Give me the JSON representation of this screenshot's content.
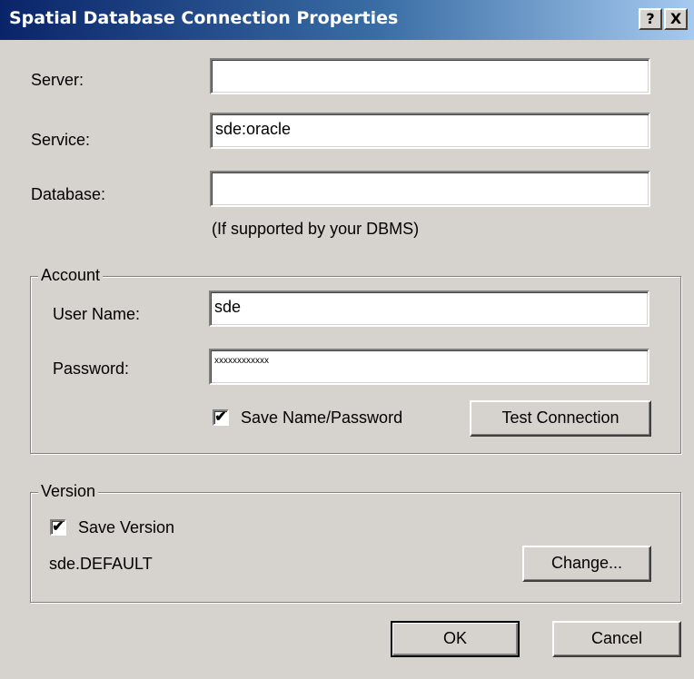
{
  "window": {
    "title": "Spatial Database Connection Properties",
    "help_glyph": "?",
    "close_glyph": "X"
  },
  "fields": {
    "server_label": "Server:",
    "server_value": "",
    "service_label": "Service:",
    "service_value": "sde:oracle",
    "database_label": "Database:",
    "database_value": "",
    "database_hint": "(If supported by your DBMS)"
  },
  "account": {
    "title": "Account",
    "user_label": "User Name:",
    "user_value": "sde",
    "password_label": "Password:",
    "password_value": "xxxxxxxxxxxx",
    "save_checked": true,
    "save_label": "Save Name/Password",
    "test_button": "Test Connection"
  },
  "version": {
    "title": "Version",
    "save_checked": true,
    "save_label": "Save Version",
    "current": "sde.DEFAULT",
    "change_button": "Change..."
  },
  "buttons": {
    "ok": "OK",
    "cancel": "Cancel"
  },
  "glyphs": {
    "check": "✔"
  }
}
